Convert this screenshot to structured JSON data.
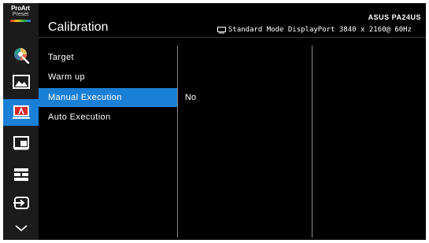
{
  "logo": {
    "line1": "ProArt",
    "line2": "Preset"
  },
  "header": {
    "title": "Calibration",
    "brand": "ASUS PA24US",
    "status": "Standard Mode DisplayPort 3840 x 2160@ 60Hz"
  },
  "rail": [
    {
      "icon": "color-palette-icon"
    },
    {
      "icon": "image-icon"
    },
    {
      "icon": "calibration-icon",
      "active": true
    },
    {
      "icon": "pip-icon"
    },
    {
      "icon": "qfit-icon"
    },
    {
      "icon": "input-select-icon"
    },
    {
      "icon": "chevron-down-icon"
    }
  ],
  "menu": {
    "items": [
      {
        "label": "Target"
      },
      {
        "label": "Warm up"
      },
      {
        "label": "Manual Execution",
        "selected": true
      },
      {
        "label": "Auto Execution"
      }
    ]
  },
  "submenu": {
    "value": "No"
  },
  "colors": {
    "accent": "#1a7fd6",
    "background": "#000000",
    "rail": "#1b1b1b"
  }
}
